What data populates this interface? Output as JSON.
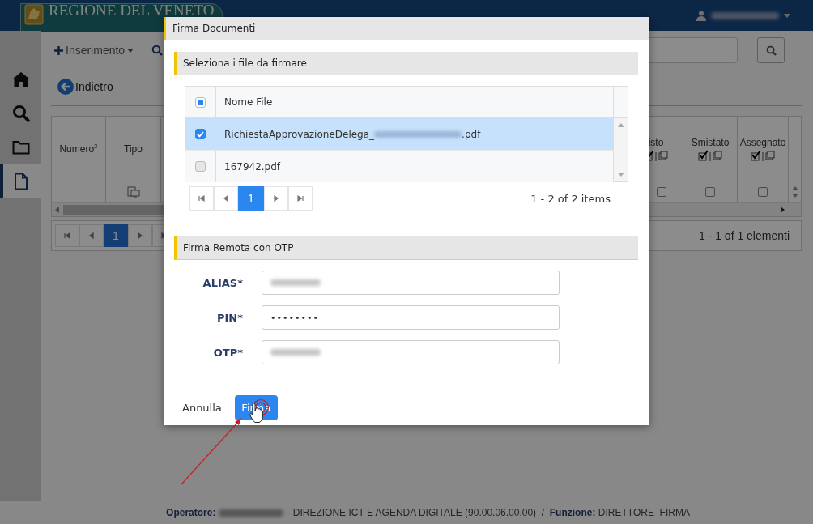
{
  "header": {
    "brand": "REGIONE DEL VENETO"
  },
  "sidebar": {
    "items": [
      {
        "kind": "home",
        "selected": false
      },
      {
        "kind": "search",
        "selected": false
      },
      {
        "kind": "folder",
        "selected": false
      },
      {
        "kind": "document",
        "selected": true
      }
    ]
  },
  "toolbar": {
    "insert_menu": "Inserimento"
  },
  "back_link": "Indietro",
  "table": {
    "columns": [
      {
        "label": "Numero$^{2}$",
        "kind": "plain"
      },
      {
        "label": "Tipo",
        "kind": "type"
      },
      {
        "label": "isto",
        "kind": "toggle",
        "checked": false
      },
      {
        "label": "Smistato",
        "kind": "toggle",
        "checked": false
      },
      {
        "label": "Assegnato",
        "kind": "toggle",
        "checked": false
      }
    ],
    "pages": [
      {
        "label": "1",
        "selected": true
      }
    ],
    "summary": "1 - 1 of 1 elementi"
  },
  "footer": {
    "operator_label": "Operatore:",
    "details": "- DIREZIONE ICT E AGENDA DIGITALE (90.00.06.00.00)  /  **Funzione:** DIRETTORE_FIRMA"
  },
  "dialog": {
    "title": "Firma Documenti",
    "files_section": {
      "title": "Seleziona i file da firmare",
      "column": "Nome File",
      "header_indeterminate": true,
      "files": [
        {
          "name": "RichiestaApprovazioneDelega_",
          "suffix": ".pdf",
          "redacted": true,
          "checked": true,
          "selected": true
        },
        {
          "name": "167942.pdf",
          "redacted": false,
          "checked": false,
          "selected": false
        }
      ],
      "pages": [
        {
          "label": "1",
          "selected": true
        }
      ],
      "summary": "1 - 2 of 2 items"
    },
    "otp_section": {
      "title": "Firma Remota con OTP",
      "fields": [
        {
          "label": "ALIAS*",
          "kind": "redacted"
        },
        {
          "label": "PIN*",
          "kind": "password",
          "value": "••••••••"
        },
        {
          "label": "OTP*",
          "kind": "redacted"
        }
      ]
    },
    "cancel": "Annulla",
    "submit": "Firma"
  }
}
